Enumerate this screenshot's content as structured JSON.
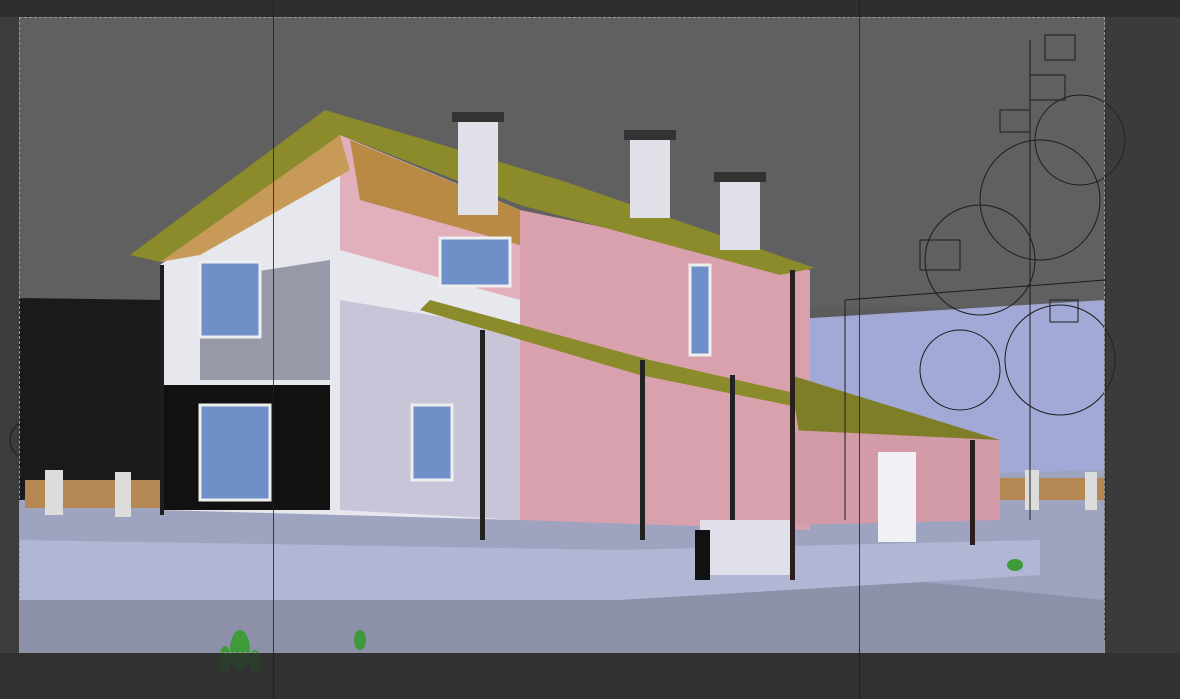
{
  "viewport": {
    "label": "",
    "render_mode": "shaded-with-wireframe"
  },
  "colors": {
    "sky": "#5e5e5e",
    "ground": "#9aa0bb",
    "wall_pink": "#d9a7b3",
    "wall_white": "#e9eaf2",
    "roof": "#8a8a2e",
    "glass": "#6f8fc8",
    "wire": "#1c1c1c",
    "frame": "#9a9a9a"
  },
  "icons": [
    "safe-frame-icon",
    "viewport-guide-icon"
  ]
}
